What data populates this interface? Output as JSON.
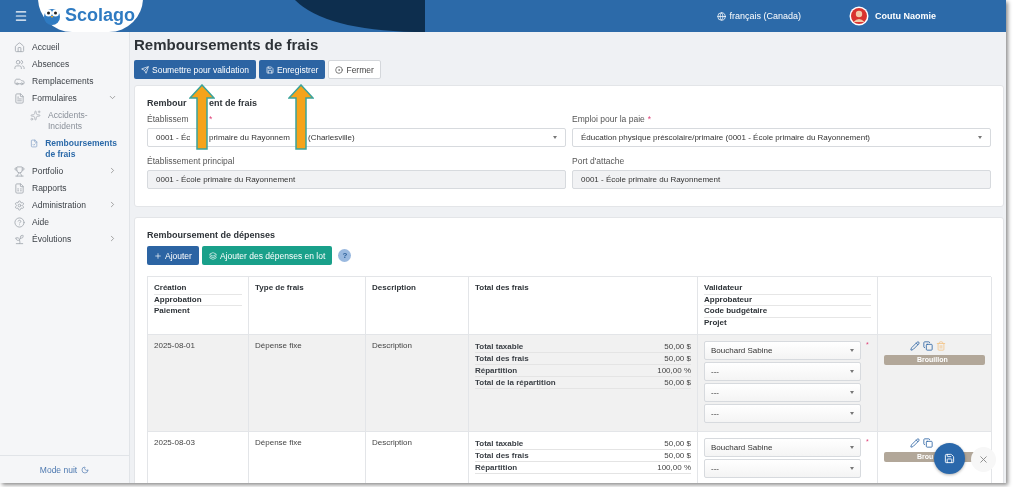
{
  "topbar": {
    "app_name": "Scolago",
    "language": "français (Canada)",
    "user": "Coutu Naomie"
  },
  "sidebar": {
    "items": [
      {
        "label": "Accueil",
        "kind": "link",
        "selected": false
      },
      {
        "label": "Absences",
        "kind": "link",
        "selected": false
      },
      {
        "label": "Remplacements",
        "kind": "link",
        "selected": false
      },
      {
        "label": "Formulaires",
        "kind": "group",
        "expanded": true,
        "selected": false,
        "children": [
          {
            "label": "Accidents-Incidents",
            "selected": false
          },
          {
            "label": "Remboursements de frais",
            "selected": true
          }
        ]
      },
      {
        "label": "Portfolio",
        "kind": "group",
        "expanded": false,
        "selected": false
      },
      {
        "label": "Rapports",
        "kind": "link",
        "selected": false
      },
      {
        "label": "Administration",
        "kind": "group",
        "expanded": false,
        "selected": false
      },
      {
        "label": "Aide",
        "kind": "link",
        "selected": false
      },
      {
        "label": "Évolutions",
        "kind": "group",
        "expanded": false,
        "selected": false
      }
    ],
    "footer": "Mode nuit"
  },
  "page": {
    "title": "Remboursements de frais",
    "actions": [
      {
        "label": "Soumettre pour validation",
        "kind": "submit"
      },
      {
        "label": "Enregistrer",
        "kind": "save"
      },
      {
        "label": "Fermer",
        "kind": "close"
      }
    ]
  },
  "form_card": {
    "title_segments": [
      "Rembour",
      "ent de frais"
    ],
    "fields": [
      {
        "label_segments": [
          "Établissem"
        ],
        "required_mark": "*",
        "value_segments": [
          "0001 - Éc",
          "primaire du Rayonnem",
          "(Charlesville)"
        ],
        "kind": "select"
      },
      {
        "label": "Emploi pour la paie",
        "required_mark": "*",
        "value": "Éducation physique préscolaire/primaire (0001 - École primaire du Rayonnement)",
        "kind": "select"
      },
      {
        "label": "Établissement principal",
        "value": "0001 - École primaire du Rayonnement",
        "kind": "readonly"
      },
      {
        "label": "Port d'attache",
        "value": "0001 - École primaire du Rayonnement",
        "kind": "readonly"
      }
    ]
  },
  "expenses": {
    "title": "Remboursement de dépenses",
    "buttons": [
      {
        "label": "Ajouter",
        "kind": "add"
      },
      {
        "label": "Ajouter des dépenses en lot",
        "kind": "batch"
      }
    ],
    "help": "?",
    "table": {
      "columns": [
        {
          "lines": [
            "Création",
            "Approbation",
            "Paiement"
          ]
        },
        {
          "lines": [
            "Type de frais"
          ]
        },
        {
          "lines": [
            "Description"
          ]
        },
        {
          "lines": [
            "Total des frais"
          ]
        },
        {
          "lines": [
            "Validateur",
            "Approbateur",
            "Code budgétaire",
            "Projet"
          ]
        }
      ],
      "rows": [
        {
          "highlighted": true,
          "date": "2025-08-01",
          "type": "Dépense fixe",
          "description": "Description",
          "totals": [
            {
              "label": "Total taxable",
              "value": "50,00 $"
            },
            {
              "label": "Total des frais",
              "value": "50,00 $"
            },
            {
              "label": "Répartition",
              "value": "100,00 %"
            },
            {
              "label": "Total de la répartition",
              "value": "50,00 $"
            }
          ],
          "assignments": [
            {
              "value": "Bouchard Sabine",
              "required_mark": "*"
            },
            {
              "value": "---"
            },
            {
              "value": "---"
            },
            {
              "value": "---"
            }
          ],
          "actions": [
            {
              "kind": "edit"
            },
            {
              "kind": "copy"
            },
            {
              "kind": "delete"
            }
          ],
          "status": "Brouillon"
        },
        {
          "highlighted": false,
          "date": "2025-08-03",
          "type": "Dépense fixe",
          "description": "Description",
          "totals": [
            {
              "label": "Total taxable",
              "value": "50,00 $"
            },
            {
              "label": "Total des frais",
              "value": "50,00 $"
            },
            {
              "label": "Répartition",
              "value": "100,00 %"
            }
          ],
          "assignments": [
            {
              "value": "Bouchard Sabine",
              "required_mark": "*"
            },
            {
              "value": "---"
            }
          ],
          "actions": [
            {
              "kind": "edit"
            },
            {
              "kind": "copy"
            }
          ],
          "status": "Brou"
        }
      ]
    }
  }
}
